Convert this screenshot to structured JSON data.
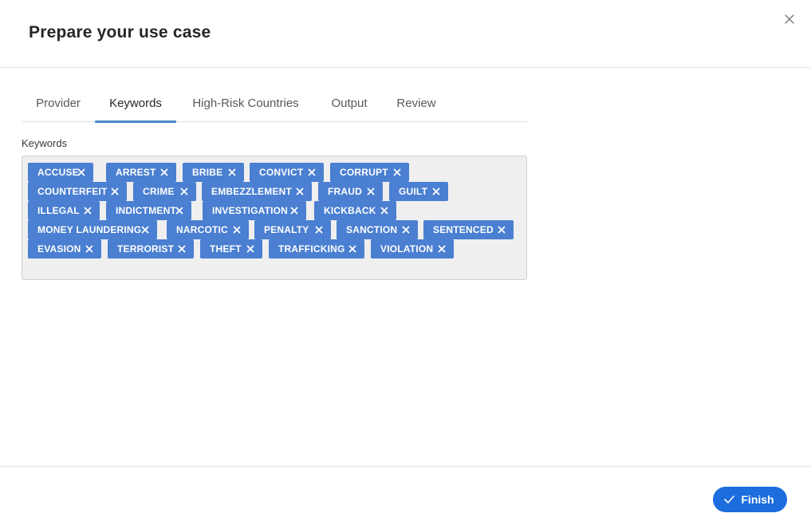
{
  "dialog": {
    "title": "Prepare your use case",
    "close_icon": "close-icon"
  },
  "tabs": [
    {
      "label": "Provider",
      "active": false
    },
    {
      "label": "Keywords",
      "active": true
    },
    {
      "label": "High-Risk Countries",
      "active": false
    },
    {
      "label": "Output",
      "active": false
    },
    {
      "label": "Review",
      "active": false
    }
  ],
  "keywords": {
    "label": "Keywords",
    "chip_remove_icon": "remove-x-icon",
    "items": [
      "ACCUSE",
      "ARREST",
      "BRIBE",
      "CONVICT",
      "CORRUPT",
      "COUNTERFEIT",
      "CRIME",
      "EMBEZZLEMENT",
      "FRAUD",
      "GUILT",
      "ILLEGAL",
      "INDICTMENT",
      "INVESTIGATION",
      "KICKBACK",
      "MONEY LAUNDERING",
      "NARCOTIC",
      "PENALTY",
      "SANCTION",
      "SENTENCED",
      "EVASION",
      "TERRORIST",
      "THEFT",
      "TRAFFICKING",
      "VIOLATION"
    ]
  },
  "footer": {
    "finish_label": "Finish",
    "finish_icon": "check-icon"
  },
  "colors": {
    "accent": "#4a86c8",
    "chip": "#4a7fd1",
    "primary_button": "#1c6dde"
  }
}
